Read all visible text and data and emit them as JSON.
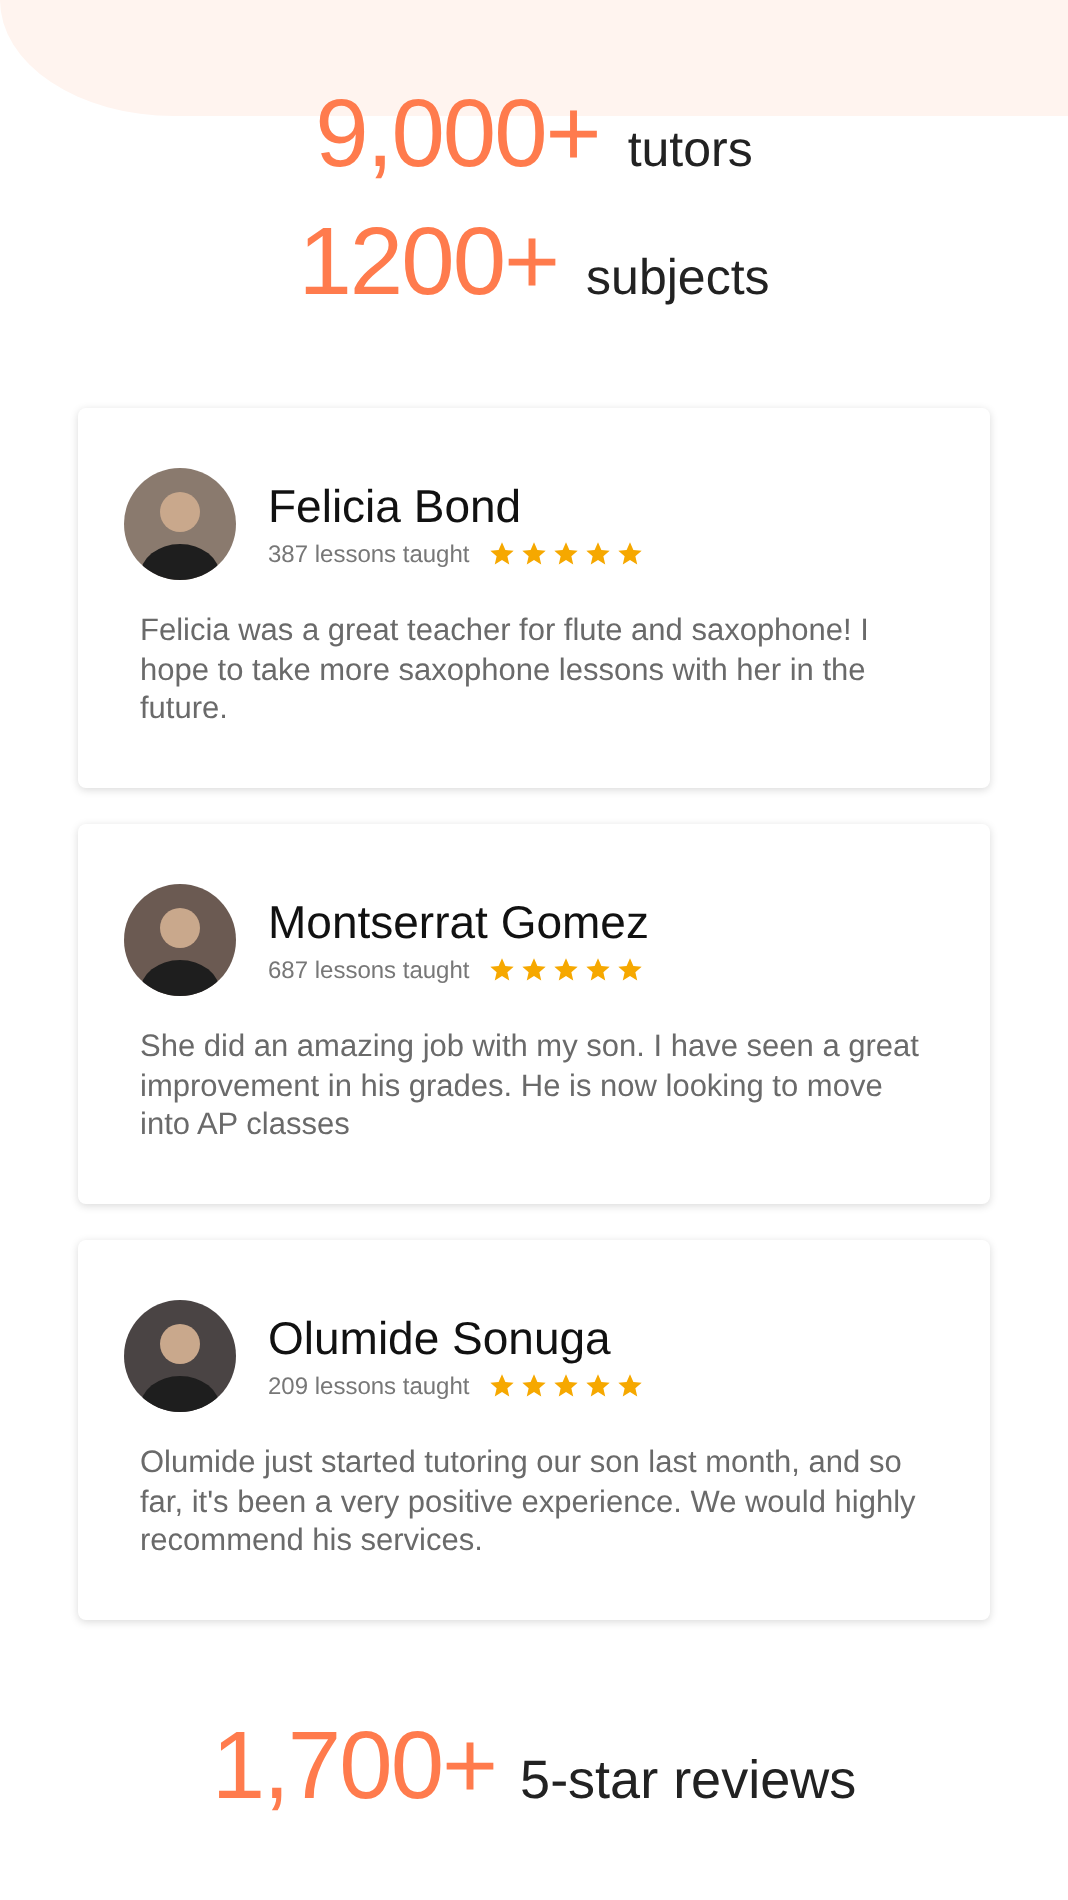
{
  "stats_top": [
    {
      "number": "9,000+",
      "label": "tutors"
    },
    {
      "number": "1200+",
      "label": "subjects"
    }
  ],
  "reviews": [
    {
      "name": "Felicia Bond",
      "lessons": "387 lessons taught",
      "stars": 5,
      "text": "Felicia was a great teacher for flute and saxophone! I hope to take more saxophone lessons with her in the future."
    },
    {
      "name": "Montserrat Gomez",
      "lessons": "687 lessons taught",
      "stars": 5,
      "text": "She did an amazing job with my son. I have seen a great improvement in his grades. He is now looking to move into AP classes"
    },
    {
      "name": "Olumide Sonuga",
      "lessons": "209 lessons taught",
      "stars": 5,
      "text": "Olumide just started tutoring our son last month, and so far, it's been a very positive experience. We would highly recommend his services."
    }
  ],
  "stat_bottom": {
    "number": "1,700+",
    "label": "5-star reviews"
  }
}
